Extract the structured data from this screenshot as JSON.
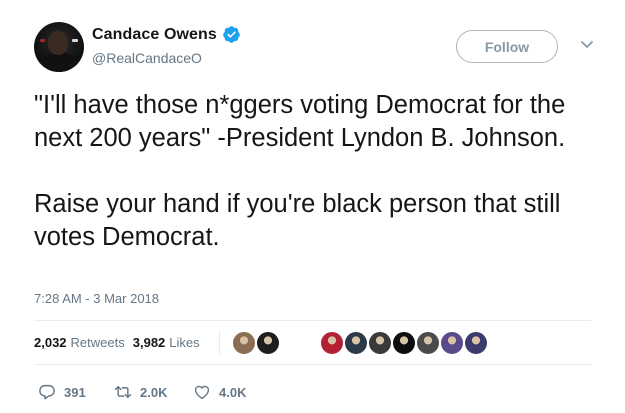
{
  "author": {
    "display_name": "Candace Owens",
    "handle": "@RealCandaceO",
    "verified": true,
    "verified_color": "#1da1f2"
  },
  "follow_button": {
    "label": "Follow"
  },
  "menu": {
    "icon": "chevron-down-icon"
  },
  "tweet": {
    "paragraphs": [
      "\"I'll have those n*ggers voting Democrat for the next 200 years\" -President Lyndon B. Johnson.",
      "Raise your hand if you're black person that still votes Democrat."
    ],
    "timestamp": "7:28 AM - 3 Mar 2018"
  },
  "stats": {
    "retweets_count": "2,032",
    "retweets_label": "Retweets",
    "likes_count": "3,982",
    "likes_label": "Likes"
  },
  "liked_by_avatars": [
    {
      "icon": "user-avatar-icon",
      "color": "#8a6d52"
    },
    {
      "icon": "user-avatar-icon",
      "color": "#1e1e1e"
    },
    {
      "icon": "texas-flag-avatar-icon",
      "color": "#b22234"
    },
    {
      "icon": "user-avatar-icon",
      "color": "#2d3a4a"
    },
    {
      "icon": "user-avatar-icon",
      "color": "#3a3a3a"
    },
    {
      "icon": "user-avatar-icon",
      "color": "#0e0e0e"
    },
    {
      "icon": "user-avatar-icon",
      "color": "#4b4b4b"
    },
    {
      "icon": "user-avatar-icon",
      "color": "#5b4a8a"
    },
    {
      "icon": "us-flag-avatar-icon",
      "color": "#3c3b6e"
    }
  ],
  "actions": {
    "replies": "391",
    "retweets": "2.0K",
    "likes": "4.0K"
  }
}
